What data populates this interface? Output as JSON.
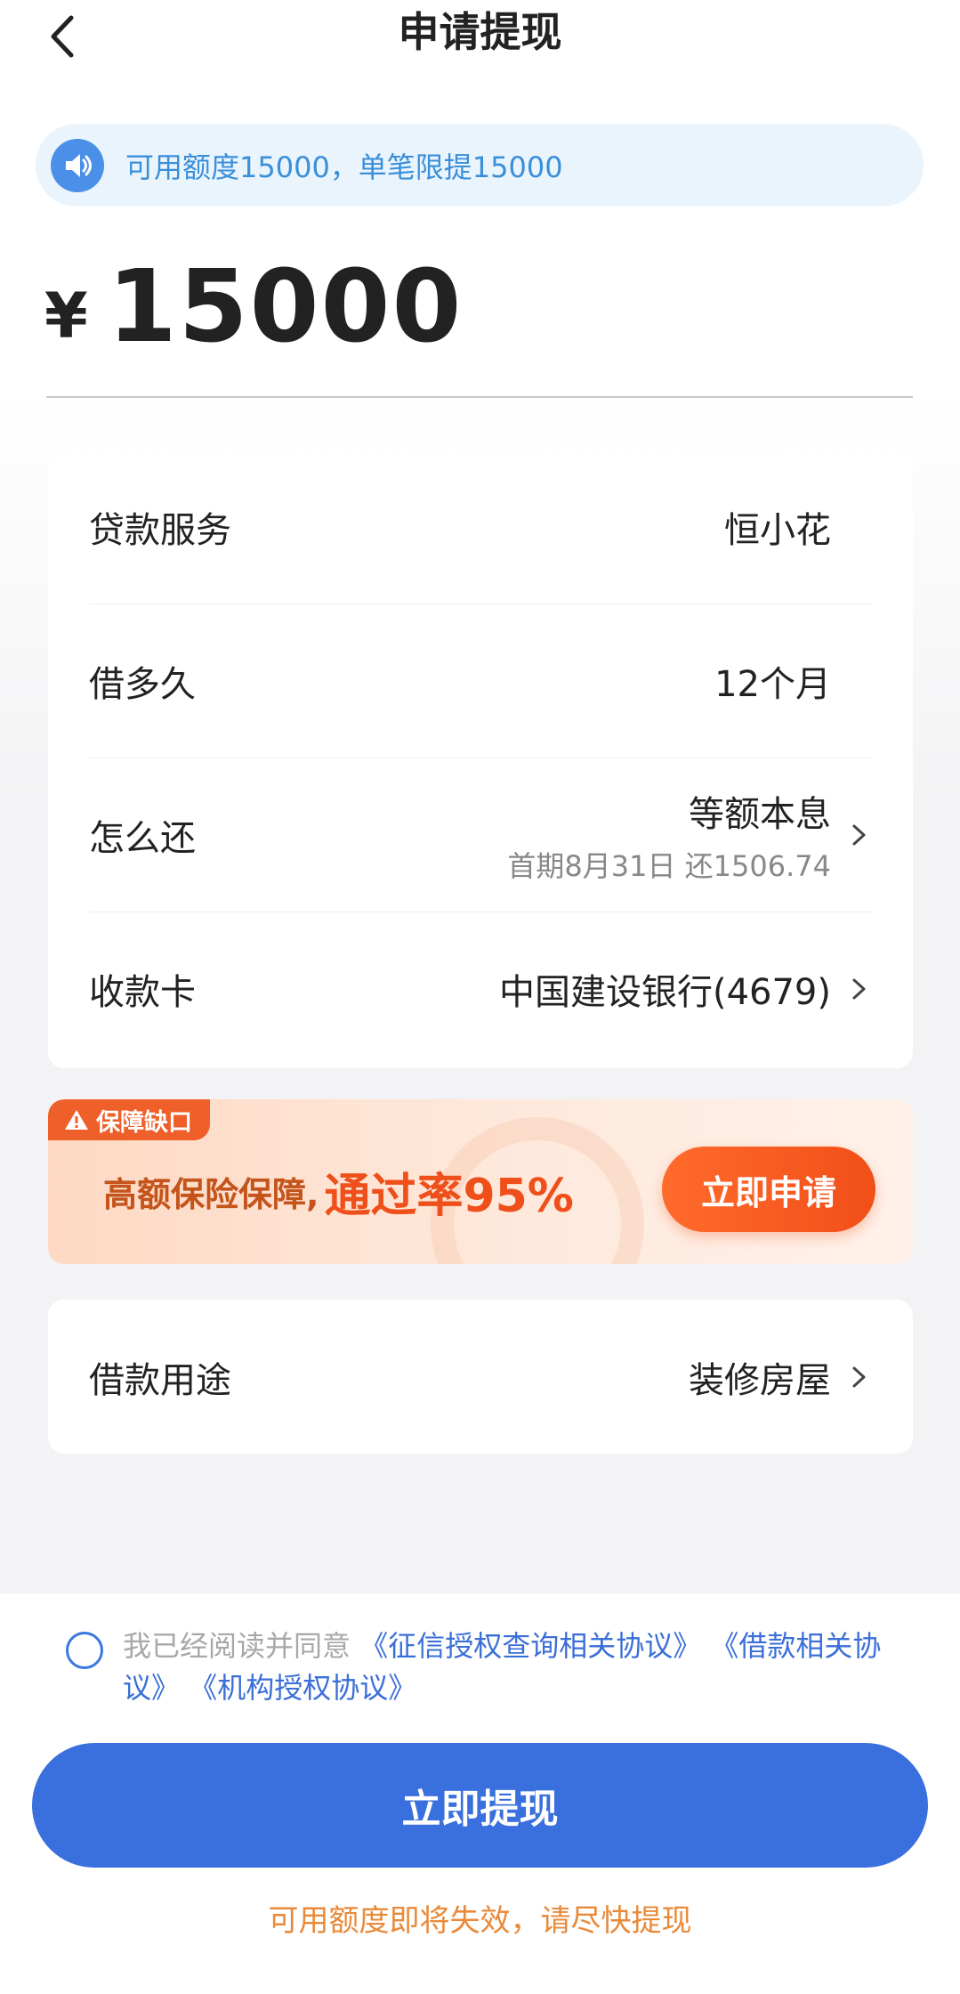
{
  "header": {
    "title": "申请提现"
  },
  "notice": {
    "text": "可用额度15000，单笔限提15000"
  },
  "amount": {
    "currency": "¥",
    "value": "15000"
  },
  "details": {
    "loan_service": {
      "label": "贷款服务",
      "value": "恒小花"
    },
    "term": {
      "label": "借多久",
      "value": "12个月"
    },
    "repayment": {
      "label": "怎么还",
      "value": "等额本息",
      "sub": "首期8月31日 还1506.74"
    },
    "card": {
      "label": "收款卡",
      "value": "中国建设银行(4679)"
    }
  },
  "banner": {
    "tag": "保障缺口",
    "text_a": "高额保险保障,",
    "text_b": "通过率95%",
    "button": "立即申请"
  },
  "purpose": {
    "label": "借款用途",
    "value": "装修房屋"
  },
  "agreement": {
    "prefix": "我已经阅读并同意 ",
    "link1": "《征信授权查询相关协议》",
    "link2": "《借款相关协议》",
    "link3": "《机构授权协议》"
  },
  "submit": {
    "label": "立即提现"
  },
  "warning": {
    "text": "可用额度即将失效，请尽快提现"
  },
  "colors": {
    "primary": "#3a6fde",
    "notice_bg": "#eaf4fd",
    "notice_text": "#3a8fd9",
    "banner_accent": "#ef4f1a",
    "warning": "#e98a3a"
  },
  "icons": {
    "back": "chevron-left-icon",
    "notice": "speaker-icon",
    "chevron": "chevron-right-icon",
    "warning": "warning-triangle-icon"
  }
}
